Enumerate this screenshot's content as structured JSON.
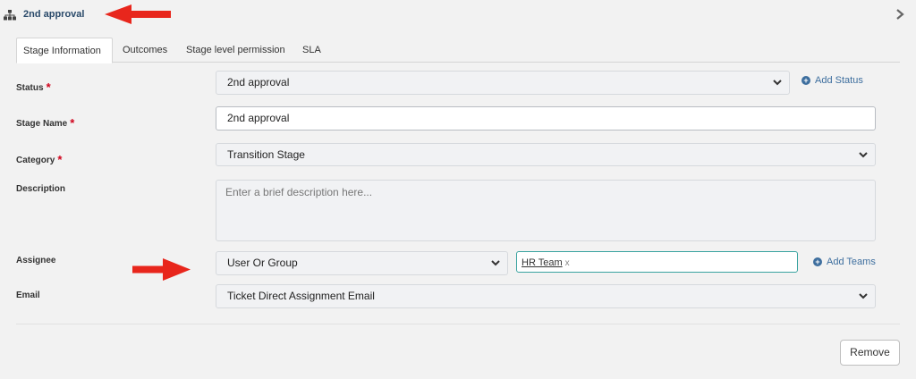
{
  "header": {
    "title": "2nd approval",
    "icon": "hierarchy-icon",
    "annotation_color": "#e8261c"
  },
  "tabs": [
    {
      "label": "Stage Information",
      "active": true
    },
    {
      "label": "Outcomes",
      "active": false
    },
    {
      "label": "Stage level permission",
      "active": false
    },
    {
      "label": "SLA",
      "active": false
    }
  ],
  "form": {
    "status": {
      "label": "Status",
      "required": "*",
      "value": "2nd approval",
      "add_label": "Add Status"
    },
    "stage_name": {
      "label": "Stage Name",
      "required": "*",
      "value": "2nd approval"
    },
    "category": {
      "label": "Category",
      "required": "*",
      "value": "Transition Stage"
    },
    "description": {
      "label": "Description",
      "placeholder": "Enter a brief description here..."
    },
    "assignee": {
      "label": "Assignee",
      "type_value": "User Or Group",
      "chip": "HR Team",
      "chip_remove": "x",
      "add_label": "Add Teams"
    },
    "email": {
      "label": "Email",
      "value": "Ticket Direct Assignment Email"
    }
  },
  "actions": {
    "remove_label": "Remove"
  }
}
